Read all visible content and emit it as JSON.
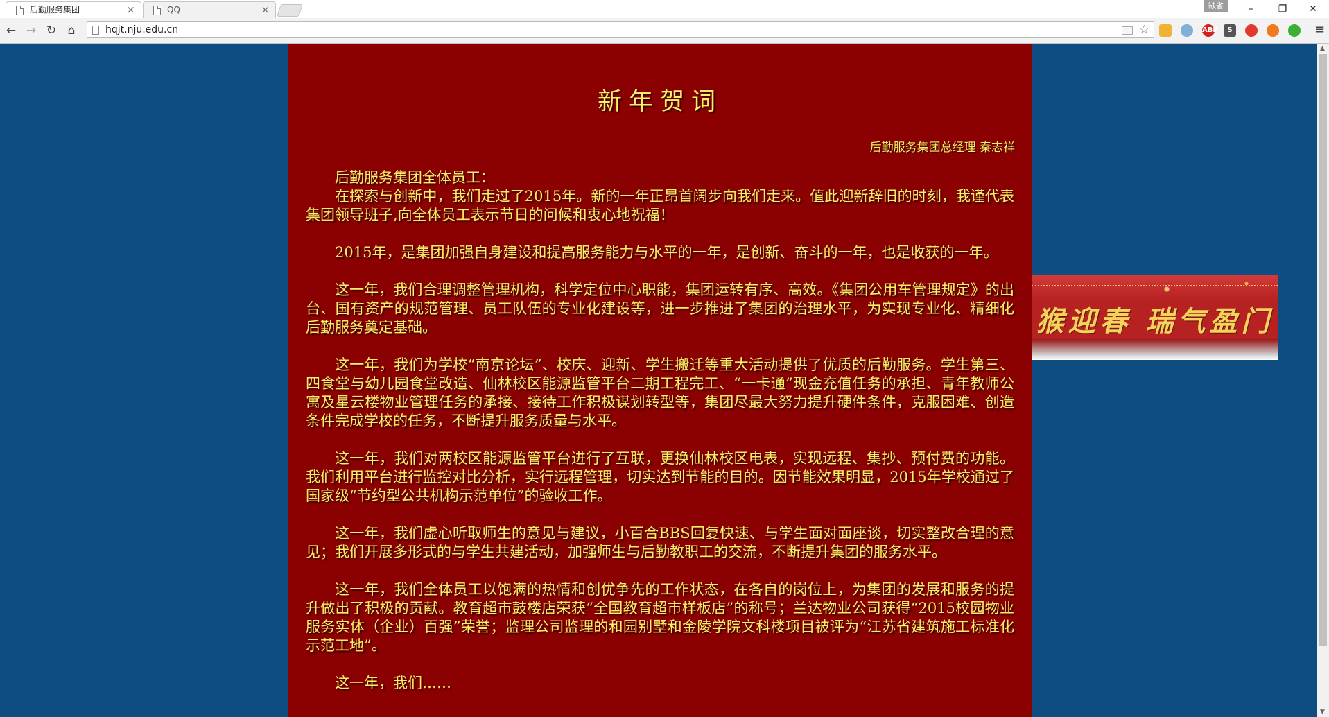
{
  "browser": {
    "tabs": [
      {
        "title": "后勤服务集团",
        "active": true
      },
      {
        "title": "QQ",
        "active": false
      }
    ],
    "profile_label": "缺省",
    "address": "hqjt.nju.edu.cn"
  },
  "page": {
    "title": "新年贺词",
    "author": "后勤服务集团总经理 秦志祥",
    "greeting": "后勤服务集团全体员工：",
    "paragraphs": [
      "在探索与创新中，我们走过了2015年。新的一年正昂首阔步向我们走来。值此迎新辞旧的时刻，我谨代表集团领导班子,向全体员工表示节日的问候和衷心地祝福！",
      "2015年，是集团加强自身建设和提高服务能力与水平的一年，是创新、奋斗的一年，也是收获的一年。",
      "这一年，我们合理调整管理机构，科学定位中心职能，集团运转有序、高效。《集团公用车管理规定》的出台、国有资产的规范管理、员工队伍的专业化建设等，进一步推进了集团的治理水平，为实现专业化、精细化后勤服务奠定基础。",
      "这一年，我们为学校“南京论坛”、校庆、迎新、学生搬迁等重大活动提供了优质的后勤服务。学生第三、四食堂与幼儿园食堂改造、仙林校区能源监管平台二期工程完工、“一卡通”现金充值任务的承担、青年教师公寓及星云楼物业管理任务的承接、接待工作积极谋划转型等，集团尽最大努力提升硬件条件，克服困难、创造条件完成学校的任务，不断提升服务质量与水平。",
      "这一年，我们对两校区能源监管平台进行了互联，更换仙林校区电表，实现远程、集抄、预付费的功能。我们利用平台进行监控对比分析，实行远程管理，切实达到节能的目的。因节能效果明显，2015年学校通过了国家级“节约型公共机构示范单位”的验收工作。",
      "这一年，我们虚心听取师生的意见与建议，小百合BBS回复快速、与学生面对面座谈，切实整改合理的意见；我们开展多形式的与学生共建活动，加强师生与后勤教职工的交流，不断提升集团的服务水平。",
      "这一年，我们全体员工以饱满的热情和创优争先的工作状态，在各自的岗位上，为集团的发展和服务的提升做出了积极的贡献。教育超市鼓楼店荣获“全国教育超市样板店”的称号；兰达物业公司获得“2015校园物业服务实体（企业）百强”荣誉；监理公司监理的和园别墅和金陵学院文科楼项目被评为“江苏省建筑施工标准化示范工地”。",
      "这一年，我们……"
    ],
    "banner_text": "猴迎春 瑞气盈门"
  },
  "colors": {
    "page_background": "#0d4d82",
    "content_background": "#8b0000",
    "text": "#ffee66"
  }
}
